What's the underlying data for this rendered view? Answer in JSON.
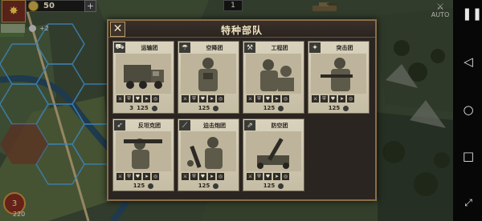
{
  "hud": {
    "coins": "50",
    "plus": "+",
    "unit_bonus": "+2",
    "top_counter": "1",
    "auto_label": "AUTO",
    "turn": "3",
    "turn_sub": "220"
  },
  "dialog": {
    "title": "特种部队",
    "close": "✕",
    "units": [
      {
        "name": "运输团",
        "icon": "truck-icon",
        "icon_glyph": "⛟",
        "supply": "3",
        "cost": "125"
      },
      {
        "name": "空降团",
        "icon": "parachute-icon",
        "icon_glyph": "☂",
        "supply": "",
        "cost": "125"
      },
      {
        "name": "工程团",
        "icon": "shovel-icon",
        "icon_glyph": "⚒",
        "supply": "",
        "cost": "125"
      },
      {
        "name": "突击团",
        "icon": "assault-icon",
        "icon_glyph": "✦",
        "supply": "",
        "cost": "125"
      },
      {
        "name": "反坦克团",
        "icon": "bazooka-icon",
        "icon_glyph": "➶",
        "supply": "",
        "cost": "125"
      },
      {
        "name": "迫击炮团",
        "icon": "mortar-icon",
        "icon_glyph": "⟋",
        "supply": "",
        "cost": "125"
      },
      {
        "name": "防空团",
        "icon": "antiair-icon",
        "icon_glyph": "⇗",
        "supply": "",
        "cost": "125"
      }
    ]
  },
  "colors": {
    "panel": "#2b2521",
    "panel_border": "#8a6e49",
    "card": "#d4ccb5",
    "title_text": "#f0e3c4"
  }
}
